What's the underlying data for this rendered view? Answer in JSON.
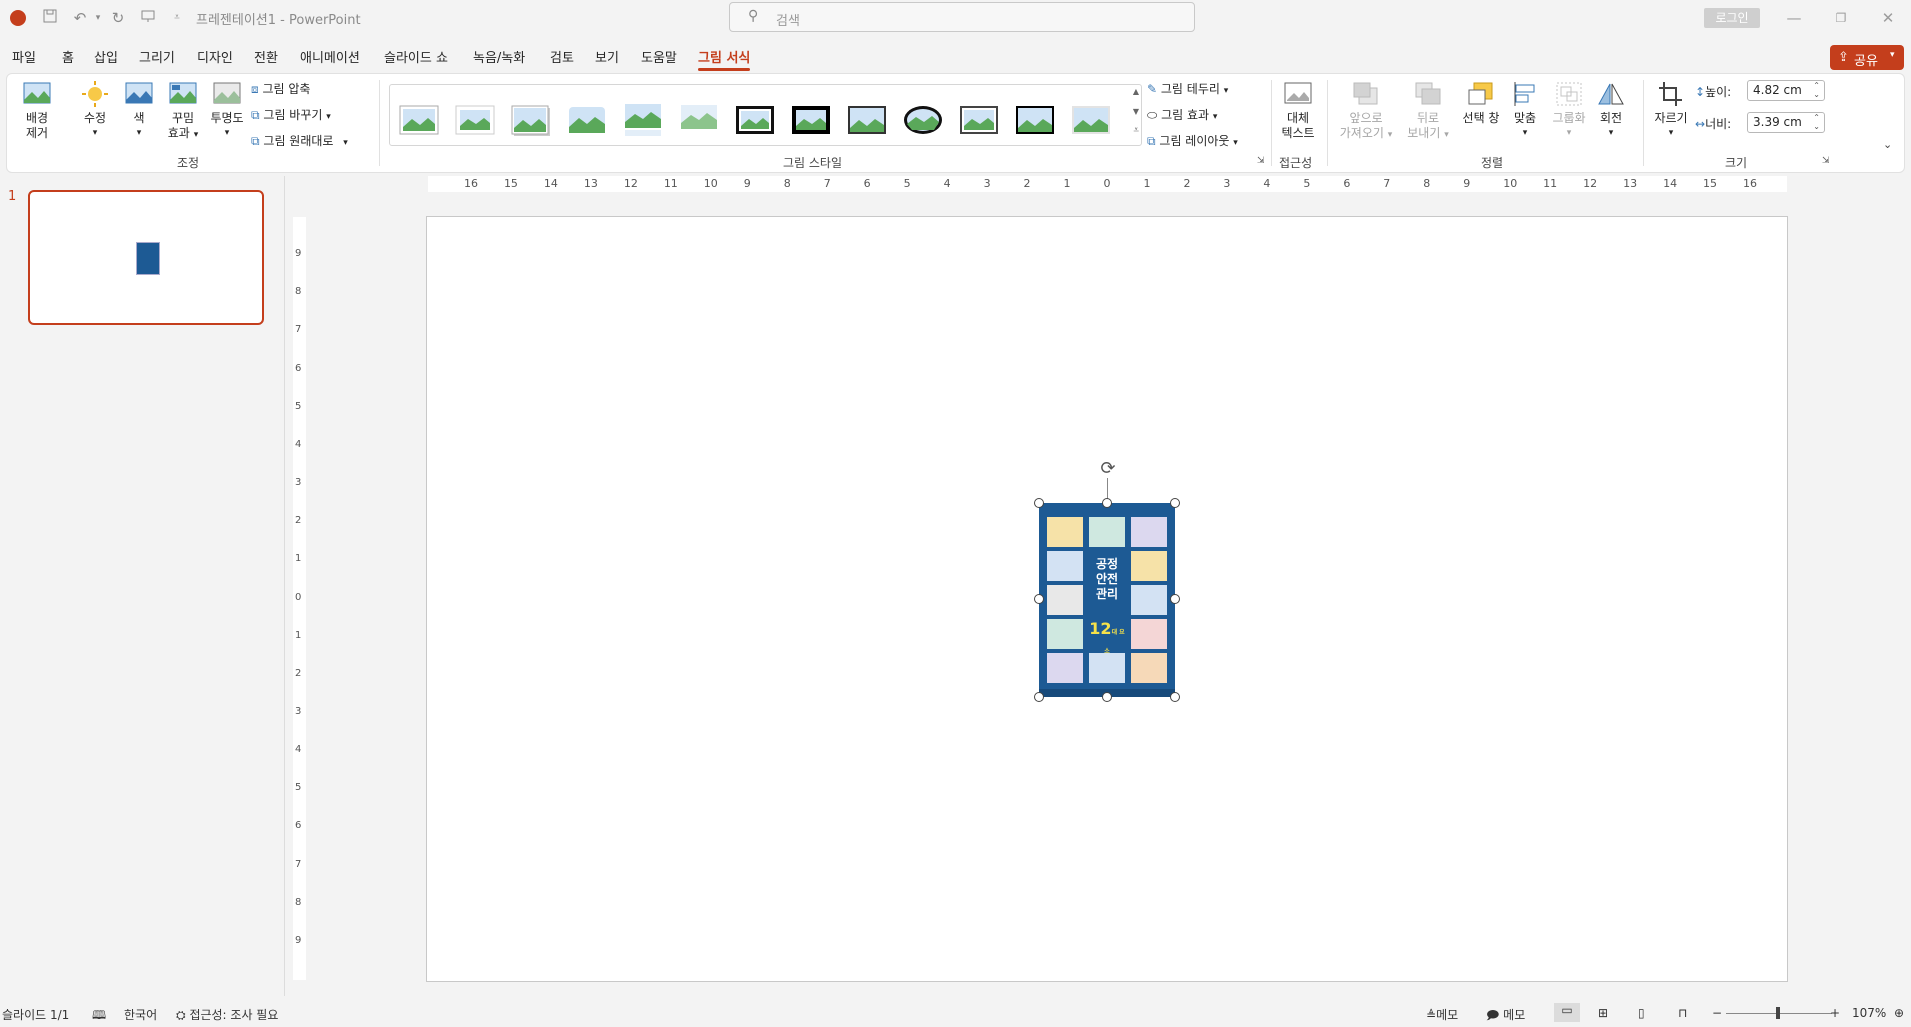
{
  "titlebar": {
    "doc_title": "프레젠테이션1  -  PowerPoint",
    "search_placeholder": "검색",
    "login_label": "로그인",
    "icons": [
      "powerpoint-logo-icon",
      "save-icon",
      "undo-icon",
      "redo-icon",
      "present-icon",
      "customize-icon",
      "minimize-icon",
      "restore-icon",
      "close-icon"
    ]
  },
  "tabs": [
    "파일",
    "홈",
    "삽입",
    "그리기",
    "디자인",
    "전환",
    "애니메이션",
    "슬라이드 쇼",
    "녹음/녹화",
    "검토",
    "보기",
    "도움말",
    "그림 서식"
  ],
  "active_tab": "그림 서식",
  "share_label": "공유",
  "ribbon": {
    "adjust": {
      "remove_bg": [
        "배경",
        "제거"
      ],
      "corrections": "수정",
      "color": "색",
      "artistic": [
        "꾸밈",
        "효과"
      ],
      "transparency": "투명도",
      "compress": "그림 압축",
      "change": "그림 바꾸기",
      "reset": "그림 원래대로",
      "group_label": "조정"
    },
    "styles": {
      "group_label": "그림 스타일",
      "border": "그림 테두리",
      "effects": "그림 효과",
      "layout": "그림 레이아웃"
    },
    "accessibility": {
      "alt_text": [
        "대체",
        "텍스트"
      ],
      "group_label": "접근성"
    },
    "arrange": {
      "bring_forward": [
        "앞으로",
        "가져오기"
      ],
      "send_backward": [
        "뒤로",
        "보내기"
      ],
      "selection_pane": "선택 창",
      "align": "맞춤",
      "group": "그룹화",
      "rotate": "회전",
      "group_label": "정렬"
    },
    "size": {
      "crop": "자르기",
      "height_label": "높이:",
      "height_value": "4.82 cm",
      "width_label": "너비:",
      "width_value": "3.39 cm",
      "group_label": "크기"
    }
  },
  "slides": {
    "number": "1"
  },
  "hruler_ticks": [
    "16",
    "15",
    "14",
    "13",
    "12",
    "11",
    "10",
    "9",
    "8",
    "7",
    "6",
    "5",
    "4",
    "3",
    "2",
    "1",
    "0",
    "1",
    "2",
    "3",
    "4",
    "5",
    "6",
    "7",
    "8",
    "9",
    "10",
    "11",
    "12",
    "13",
    "14",
    "15",
    "16"
  ],
  "vruler_ticks": [
    "9",
    "8",
    "7",
    "6",
    "5",
    "4",
    "3",
    "2",
    "1",
    "0",
    "1",
    "2",
    "3",
    "4",
    "5",
    "6",
    "7",
    "8",
    "9"
  ],
  "picture": {
    "title": [
      "공정",
      "안전",
      "관리"
    ],
    "count": "12",
    "suffix": "대 요소"
  },
  "statusbar": {
    "slide_info": "슬라이드 1/1",
    "language": "한국어",
    "accessibility": "접근성: 조사 필요",
    "notes": "메모",
    "comments": "메모",
    "zoom": "107%"
  },
  "colors": {
    "accent": "#c43e1c",
    "picture_bg": "#1d5a94"
  }
}
